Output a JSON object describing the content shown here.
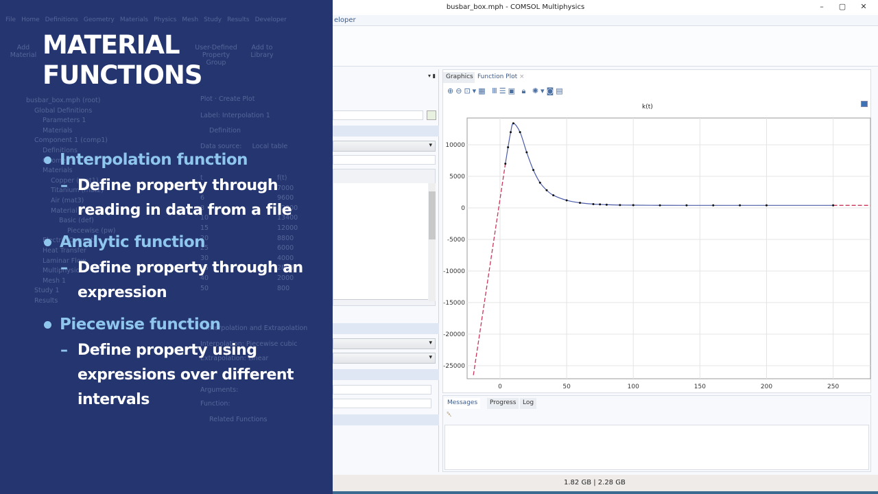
{
  "window": {
    "title": "busbar_box.mph - COMSOL Multiphysics",
    "minimize": "–",
    "maximize": "▢",
    "close": "✕",
    "help": "?"
  },
  "ribbon": {
    "tab_partial": "eloper"
  },
  "background_ui": {
    "tabs": [
      "File",
      "Home",
      "Definitions",
      "Geometry",
      "Materials",
      "Physics",
      "Mesh",
      "Study",
      "Results",
      "Developer"
    ],
    "ribbon_buttons": [
      "Add Material",
      "User-Defined Property Group",
      "Add to Library"
    ],
    "tree": [
      "busbar_box.mph (root)",
      "Global Definitions",
      "Parameters 1",
      "Materials",
      "Component 1 (comp1)",
      "Definitions",
      "Geometry 1",
      "Materials",
      "Copper (mat1)",
      "Titanium (mat2)",
      "Air (mat3)",
      "Material 4",
      "Basic (def)",
      "Piecewise (pw)",
      "Electric Currents",
      "Heat Transfer",
      "Laminar Flow",
      "Multiphysics",
      "Mesh 1",
      "Study 1",
      "Results"
    ],
    "settings": {
      "plot": "Plot",
      "create_plot": "Create Plot",
      "label_key": "Label:",
      "label_value": "Interpolation 1",
      "definition": "Definition",
      "data_source_key": "Data source:",
      "data_source_value": "Local table",
      "interp_section": "Interpolation and Extrapolation",
      "interpolation_key": "Interpolation:",
      "interpolation_value": "Piecewise cubic",
      "extrapolation_key": "Extrapolation:",
      "extrapolation_value": "Linear",
      "arguments_key": "Arguments:",
      "function_key": "Function:",
      "related": "Related Functions"
    },
    "table": {
      "headers": [
        "t",
        "f(t)"
      ],
      "rows": [
        [
          "4",
          "7000"
        ],
        [
          "6",
          "9600"
        ],
        [
          "8",
          "12000"
        ],
        [
          "10",
          "13400"
        ],
        [
          "15",
          "12000"
        ],
        [
          "20",
          "8800"
        ],
        [
          "25",
          "6000"
        ],
        [
          "30",
          "4000"
        ],
        [
          "35",
          "2800"
        ],
        [
          "40",
          "2000"
        ],
        [
          "50",
          "800"
        ]
      ]
    }
  },
  "slide": {
    "title_line1": "MATERIAL",
    "title_line2": "FUNCTIONS",
    "bullets": [
      {
        "heading": "Interpolation function",
        "detail": "Define property through\nreading in data from a file"
      },
      {
        "heading": "Analytic function",
        "detail": "Define property through an\nexpression"
      },
      {
        "heading": "Piecewise function",
        "detail": "Define property using\nexpressions over different\nintervals"
      }
    ]
  },
  "graphics": {
    "tabs": [
      "Graphics",
      "Function Plot"
    ],
    "close": "×"
  },
  "messages": {
    "tabs": [
      "Messages",
      "Progress",
      "Log"
    ]
  },
  "status": {
    "memory": "1.82 GB | 2.28 GB"
  },
  "chart_data": {
    "type": "line",
    "title": "k(t)",
    "xlabel": "",
    "ylabel": "",
    "xlim": [
      -24.7,
      278
    ],
    "ylim": [
      -27070,
      14240
    ],
    "xticks": [
      0,
      50,
      100,
      150,
      200,
      250
    ],
    "yticks": [
      10000,
      5000,
      0,
      -5000,
      -10000,
      -15000,
      -20000,
      -25000
    ],
    "points": {
      "x": [
        4,
        6,
        8,
        10,
        15,
        20,
        25,
        30,
        35,
        40,
        50,
        60,
        70,
        75,
        80,
        90,
        100,
        120,
        140,
        160,
        180,
        200,
        250
      ],
      "y": [
        7000,
        9600,
        12000,
        13400,
        12000,
        8800,
        6000,
        4000,
        2800,
        2000,
        1200,
        800,
        600,
        550,
        500,
        450,
        430,
        410,
        400,
        400,
        400,
        400,
        400
      ]
    },
    "extrapolation": {
      "left": [
        [
          -20,
          -26500
        ],
        [
          4,
          7000
        ]
      ],
      "right": [
        [
          250,
          400
        ],
        [
          278,
          400
        ]
      ]
    },
    "colors": {
      "curve": "#4a5aa8",
      "extrapolation": "#c8365a",
      "points": "#111111"
    }
  }
}
